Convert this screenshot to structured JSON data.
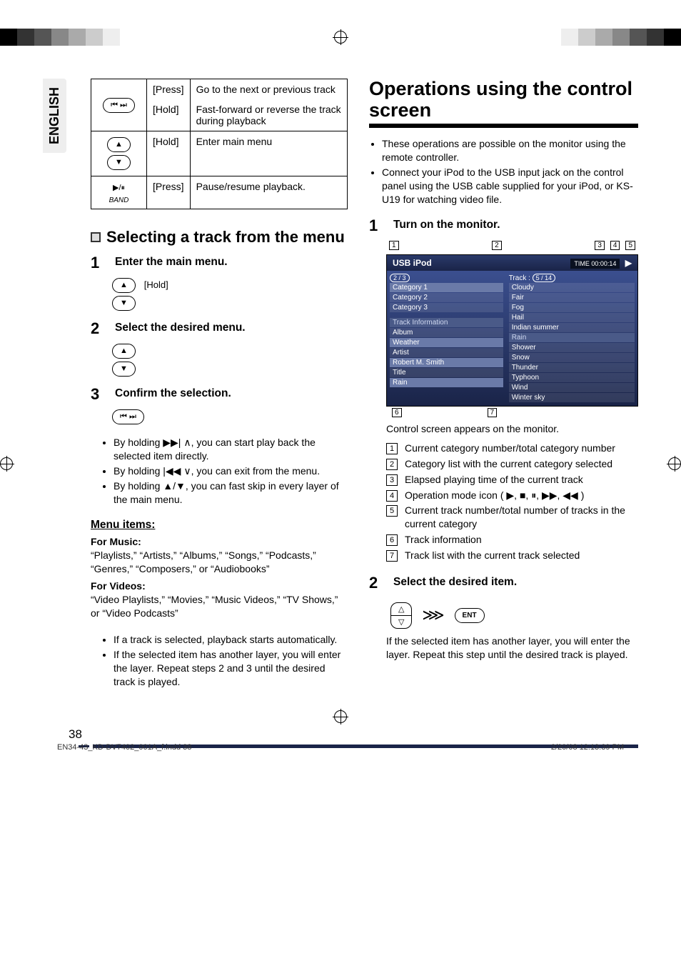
{
  "lang_tab": "ENGLISH",
  "ctrl_table": [
    {
      "icon": "⏮ ⏭",
      "rows": [
        {
          "mode": "[Press]",
          "desc": "Go to the next or previous track"
        },
        {
          "mode": "[Hold]",
          "desc": "Fast-forward or reverse the track during playback"
        }
      ]
    },
    {
      "icon": "▲ / ▼",
      "rows": [
        {
          "mode": "[Hold]",
          "desc": "Enter main menu"
        }
      ]
    },
    {
      "icon": "▶/⏸  BAND",
      "rows": [
        {
          "mode": "[Press]",
          "desc": "Pause/resume playback."
        }
      ]
    }
  ],
  "left": {
    "heading": "Selecting a track from the menu",
    "step1": {
      "num": "1",
      "title": "Enter the main menu.",
      "hold": "[Hold]"
    },
    "step2": {
      "num": "2",
      "title": "Select the desired menu."
    },
    "step3": {
      "num": "3",
      "title": "Confirm the selection."
    },
    "bullets": [
      "By holding ▶▶| ∧, you can start play back the selected item directly.",
      "By holding |◀◀ ∨, you can exit from the menu.",
      "By holding ▲/▼, you can fast skip in every layer of the main menu."
    ],
    "menu": {
      "heading": "Menu items:",
      "music_head": "For Music:",
      "music_text": "“Playlists,” “Artists,” “Albums,” “Songs,” “Podcasts,” “Genres,” “Composers,” or “Audiobooks”",
      "videos_head": "For Videos:",
      "videos_text": "“Video Playlists,” “Movies,” “Music Videos,” “TV Shows,” or “Video Podcasts”"
    },
    "post_bullets": [
      "If a track is selected, playback starts automatically.",
      "If the selected item has another layer, you will enter the layer. Repeat steps 2 and 3 until the desired track is played."
    ]
  },
  "right": {
    "title": "Operations using the control screen",
    "intro": [
      "These operations are possible on the monitor using the remote controller.",
      "Connect your iPod to the USB input jack on the control panel using the USB cable supplied for your iPod, or KS-U19 for watching video file."
    ],
    "step1": {
      "num": "1",
      "title": "Turn on the monitor."
    },
    "screen": {
      "callouts_top": [
        "1",
        "2",
        "3",
        "4",
        "5"
      ],
      "callouts_bot": [
        "6",
        "7"
      ],
      "header_left": "USB iPod",
      "header_time_label": "TIME",
      "header_time": "00:00:14",
      "badge_left": "2 / 3",
      "track_label": "Track :",
      "track_badge": "5 / 14",
      "cat_rows": [
        "Category 1",
        "Category 2",
        "Category 3"
      ],
      "info_head": "Track Information",
      "info_rows": [
        {
          "k": "Album",
          "v": "Weather"
        },
        {
          "k": "Artist",
          "v": "Robert M. Smith"
        },
        {
          "k": "Title",
          "v": "Rain"
        }
      ],
      "info_left_display": [
        "Album",
        "Weather",
        "Artist",
        "Robert M. Smith",
        "Title",
        "Rain"
      ],
      "list_rows_a": [
        "Cloudy",
        "Fair",
        "Fog",
        "Hail",
        "Indian summer"
      ],
      "list_rows_b_head": "Rain",
      "list_rows_b": [
        "Shower",
        "Snow",
        "Thunder",
        "Typhoon",
        "Wind",
        "Winter sky"
      ]
    },
    "caption": "Control screen appears on the monitor.",
    "desc": [
      "Current category number/total category number",
      "Category list with the current category selected",
      "Elapsed playing time of the current track",
      "Operation mode icon ( ▶, ■, ⏸, ▶▶, ◀◀ )",
      "Current track number/total number of tracks in the current category",
      "Track information",
      "Track list with the current track selected"
    ],
    "step2": {
      "num": "2",
      "title": "Select the desired item.",
      "ent": "ENT",
      "text": "If the selected item has another layer, you will enter the layer. Repeat this step until the desired track is played."
    }
  },
  "page_number": "38",
  "footer": {
    "left": "EN34-43_KD-DV7402_001A_f.indd   38",
    "right": "2/20/08   12:13:39 PM"
  }
}
